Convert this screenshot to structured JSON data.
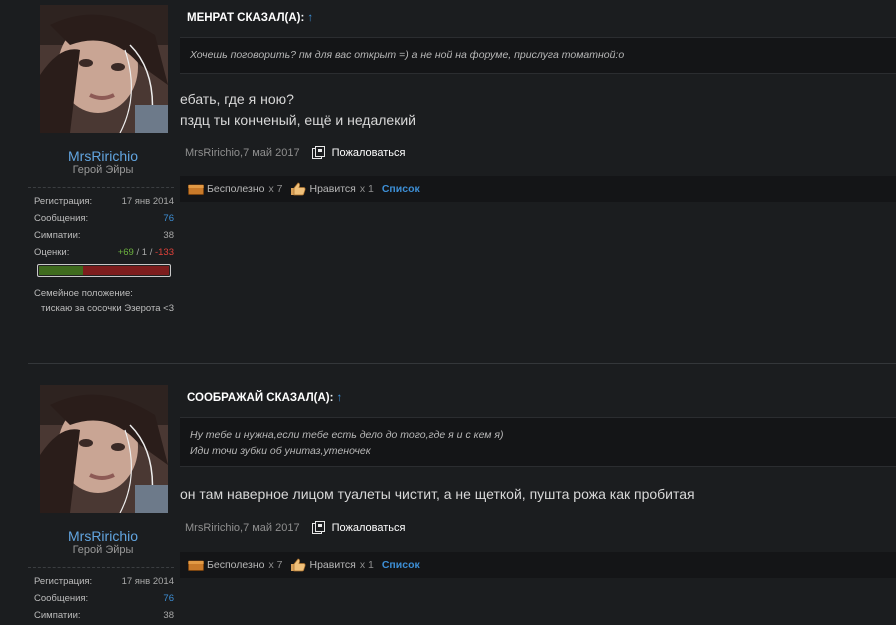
{
  "posts": [
    {
      "user": {
        "name": "MrsRirichio",
        "title": "Герой Эйры",
        "stats": [
          {
            "label": "Регистрация:",
            "value": "17 янв 2014"
          },
          {
            "label": "Сообщения:",
            "value": "76"
          },
          {
            "label": "Симпатии:",
            "value": "38"
          }
        ],
        "rating_label": "Оценки:",
        "rating_pos": "+69",
        "rating_sep1": " / ",
        "rating_neutral": "1",
        "rating_sep2": " / ",
        "rating_neg": "-133",
        "rating_positive_fraction": 0.34,
        "family_label": "Семейное положение:",
        "family_value": "тискаю за сосочки Эзерота <3"
      },
      "quote_header": "МЕНРАТ СКАЗАЛ(А):",
      "quote_arrow": "↑",
      "quote_lines": [
        "Хочешь поговорить? пм для вас открыт =) а не ной на форуме, прислуга томатной:о"
      ],
      "message_lines": [
        "ебать, где я ною?",
        "пздц ты конченый, ещё и недалекий"
      ],
      "meta": {
        "author": "MrsRirichio",
        "date": "7 май 2017",
        "report": "Пожаловаться"
      },
      "ratings": {
        "useless": "Бесполезно",
        "useless_count": "x 7",
        "like": "Нравится",
        "like_count": "x 1",
        "list": "Список"
      }
    },
    {
      "user": {
        "name": "MrsRirichio",
        "title": "Герой Эйры",
        "stats": [
          {
            "label": "Регистрация:",
            "value": "17 янв 2014"
          },
          {
            "label": "Сообщения:",
            "value": "76"
          },
          {
            "label": "Симпатии:",
            "value": "38"
          }
        ]
      },
      "quote_header": "СООБРАЖАЙ СКАЗАЛ(А):",
      "quote_arrow": "↑",
      "quote_lines": [
        "Ну тебе и нужна,если тебе есть дело до того,где я и с кем я)",
        "Иди точи зубки об унитаз,утеночек"
      ],
      "message_lines": [
        "он там наверное лицом туалеты чистит, а не щеткой, пушта рожа как пробитая"
      ],
      "meta": {
        "author": "MrsRirichio",
        "date": "7 май 2017",
        "report": "Пожаловаться"
      },
      "ratings": {
        "useless": "Бесполезно",
        "useless_count": "x 7",
        "like": "Нравится",
        "like_count": "x 1",
        "list": "Список"
      }
    }
  ],
  "colors": {
    "username": "#62a5e0",
    "link": "#3d8fd6",
    "positive": "#6db33f",
    "negative": "#e0413a"
  }
}
